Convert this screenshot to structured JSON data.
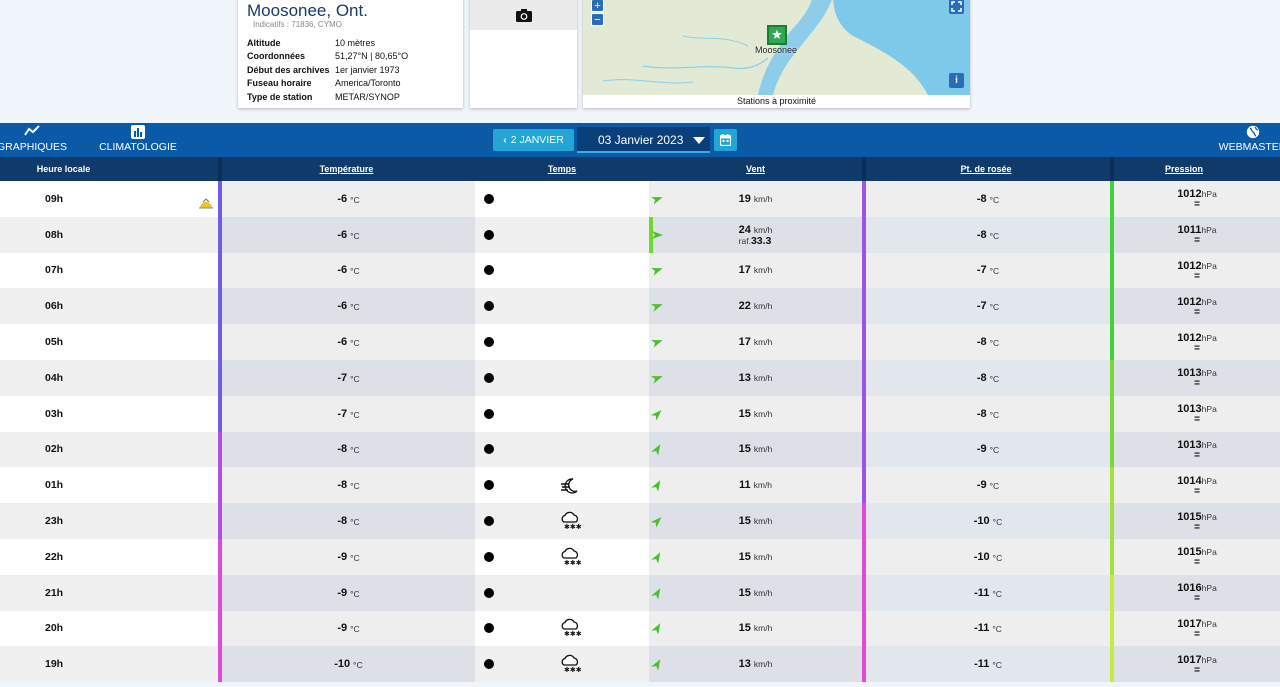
{
  "station": {
    "name": "Moosonee, Ont.",
    "indicatifs": "Indicatifs : 71836, CYMO",
    "details": [
      {
        "label": "Altitude",
        "value": "10 mètres"
      },
      {
        "label": "Coordonnées",
        "value": "51,27°N | 80,65°O"
      },
      {
        "label": "Début des archives",
        "value": "1er janvier 1973"
      },
      {
        "label": "Fuseau horaire",
        "value": "America/Toronto"
      },
      {
        "label": "Type de station",
        "value": "METAR/SYNOP"
      }
    ]
  },
  "map": {
    "pin_label": "Moosonee",
    "caption": "Stations à proximité",
    "zoom_in": "+",
    "zoom_out": "−",
    "info": "i"
  },
  "nav": {
    "graphiques": "GRAPHIQUES",
    "climatologie": "CLIMATOLOGIE",
    "prev_day": "2 JANVIER",
    "date": "03 Janvier 2023",
    "webmaster": "WEBMASTER"
  },
  "columns": {
    "hour": "Heure locale",
    "temp": "Température",
    "temps": "Temps",
    "wind": "Vent",
    "dew": "Pt. de rosée",
    "pressure": "Pression"
  },
  "units": {
    "temp": "°C",
    "wind": "km/h",
    "pressure": "hPa",
    "gust_prefix": "raf."
  },
  "colors": {
    "header": "#0f3a6a",
    "nav": "#0a5aa8",
    "accent": "#23a6d5"
  },
  "rows": [
    {
      "hour": "09h",
      "temp": "-6",
      "wind": "19",
      "gust": "",
      "dew": "-8",
      "pressure": "1012",
      "trend": "=",
      "weather": "",
      "wind_dir": 250
    },
    {
      "hour": "08h",
      "temp": "-6",
      "wind": "24",
      "gust": "33.3",
      "dew": "-8",
      "pressure": "1011",
      "trend": "=",
      "weather": "",
      "wind_dir": 270
    },
    {
      "hour": "07h",
      "temp": "-6",
      "wind": "17",
      "gust": "",
      "dew": "-7",
      "pressure": "1012",
      "trend": "=",
      "weather": "",
      "wind_dir": 250
    },
    {
      "hour": "06h",
      "temp": "-6",
      "wind": "22",
      "gust": "",
      "dew": "-7",
      "pressure": "1012",
      "trend": "=",
      "weather": "",
      "wind_dir": 250
    },
    {
      "hour": "05h",
      "temp": "-6",
      "wind": "17",
      "gust": "",
      "dew": "-8",
      "pressure": "1012",
      "trend": "=",
      "weather": "",
      "wind_dir": 250
    },
    {
      "hour": "04h",
      "temp": "-7",
      "wind": "13",
      "gust": "",
      "dew": "-8",
      "pressure": "1013",
      "trend": "=",
      "weather": "",
      "wind_dir": 250
    },
    {
      "hour": "03h",
      "temp": "-7",
      "wind": "15",
      "gust": "",
      "dew": "-8",
      "pressure": "1013",
      "trend": "=",
      "weather": "",
      "wind_dir": 225
    },
    {
      "hour": "02h",
      "temp": "-8",
      "wind": "15",
      "gust": "",
      "dew": "-9",
      "pressure": "1013",
      "trend": "=",
      "weather": "",
      "wind_dir": 210
    },
    {
      "hour": "01h",
      "temp": "-8",
      "wind": "11",
      "gust": "",
      "dew": "-9",
      "pressure": "1014",
      "trend": "=",
      "weather": "haze",
      "wind_dir": 210
    },
    {
      "hour": "23h",
      "temp": "-8",
      "wind": "15",
      "gust": "",
      "dew": "-10",
      "pressure": "1015",
      "trend": "=",
      "weather": "snow",
      "wind_dir": 225
    },
    {
      "hour": "22h",
      "temp": "-9",
      "wind": "15",
      "gust": "",
      "dew": "-10",
      "pressure": "1015",
      "trend": "=",
      "weather": "snow",
      "wind_dir": 210
    },
    {
      "hour": "21h",
      "temp": "-9",
      "wind": "15",
      "gust": "",
      "dew": "-11",
      "pressure": "1016",
      "trend": "=",
      "weather": "",
      "wind_dir": 210
    },
    {
      "hour": "20h",
      "temp": "-9",
      "wind": "15",
      "gust": "",
      "dew": "-11",
      "pressure": "1017",
      "trend": "=",
      "weather": "snow",
      "wind_dir": 210
    },
    {
      "hour": "19h",
      "temp": "-10",
      "wind": "13",
      "gust": "",
      "dew": "-11",
      "pressure": "1017",
      "trend": "=",
      "weather": "snow",
      "wind_dir": 210
    }
  ]
}
